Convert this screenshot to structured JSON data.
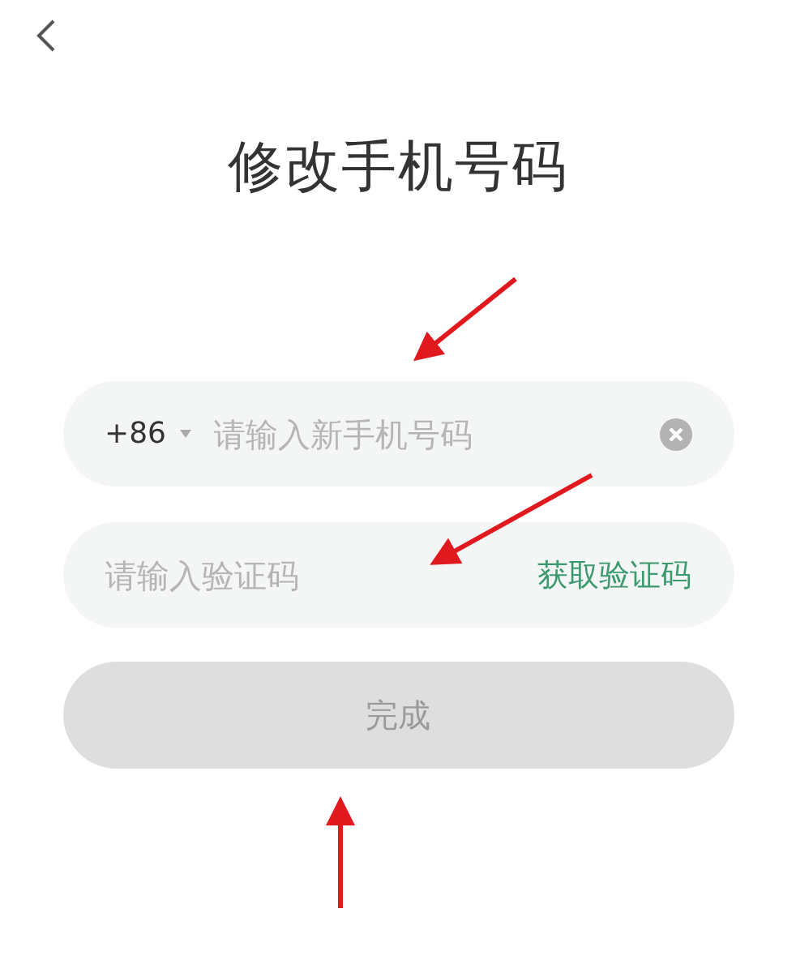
{
  "title": "修改手机号码",
  "phone_field": {
    "country_code": "+86",
    "placeholder": "请输入新手机号码"
  },
  "code_field": {
    "placeholder": "请输入验证码",
    "action": "获取验证码"
  },
  "submit_button": {
    "label": "完成",
    "disabled": true
  }
}
